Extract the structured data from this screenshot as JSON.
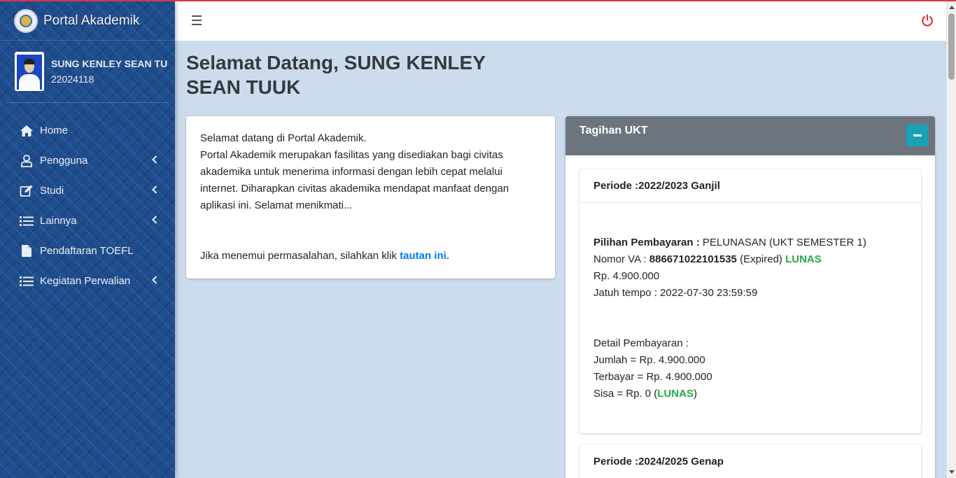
{
  "brand": {
    "title": "Portal Akademik"
  },
  "user": {
    "name": "SUNG KENLEY SEAN TUUK",
    "nim": "22024118"
  },
  "nav": {
    "items": [
      {
        "label": "Home",
        "icon": "home-icon"
      },
      {
        "label": "Pengguna",
        "icon": "user-icon",
        "expandable": true
      },
      {
        "label": "Studi",
        "icon": "edit-icon",
        "expandable": true
      },
      {
        "label": "Lainnya",
        "icon": "list-icon",
        "expandable": true
      },
      {
        "label": "Pendaftaran TOEFL",
        "icon": "file-icon"
      },
      {
        "label": "Kegiatan Perwalian",
        "icon": "list-icon",
        "expandable": true
      }
    ]
  },
  "welcome": {
    "prefix": "Selamat Datang,",
    "name": "SUNG KENLEY SEAN TUUK"
  },
  "intro": {
    "line1": "Selamat datang di Portal Akademik.",
    "paragraph": "Portal Akademik merupakan fasilitas yang disediakan bagi civitas akademika untuk menerima informasi dengan lebih cepat melalui internet. Diharapkan civitas akademika mendapat manfaat dengan aplikasi ini. Selamat menikmati...",
    "help_text": "Jika menemui permasalahan, silahkan klik",
    "help_link": "tautan ini."
  },
  "ukt": {
    "title": "Tagihan UKT",
    "periods": [
      {
        "periode": "Periode :2022/2023 Ganjil",
        "pilihan_label": "Pilihan Pembayaran :",
        "pilihan_value": "PELUNASAN (UKT SEMESTER 1)",
        "va_label": "Nomor VA :",
        "va_number": "886671022101535",
        "va_status": "(Expired)",
        "va_paid": "LUNAS",
        "amount": "Rp. 4.900.000",
        "due": "Jatuh tempo : 2022-07-30 23:59:59",
        "detail_title": "Detail Pembayaran :",
        "jumlah": "Jumlah = Rp. 4.900.000",
        "terbayar": "Terbayar = Rp. 4.900.000",
        "sisa_prefix": "Sisa = Rp. 0 (",
        "sisa_status": "LUNAS",
        "sisa_suffix": ")"
      },
      {
        "periode": "Periode :2024/2025 Genap"
      }
    ]
  },
  "colors": {
    "sidebar": "#1f4e8f",
    "header_ukt": "#6c757d",
    "collapse_button": "#17a2b8",
    "paid": "#28a745",
    "link": "#007bff",
    "logout": "#dc3545",
    "content_bg": "#ccdcec"
  }
}
